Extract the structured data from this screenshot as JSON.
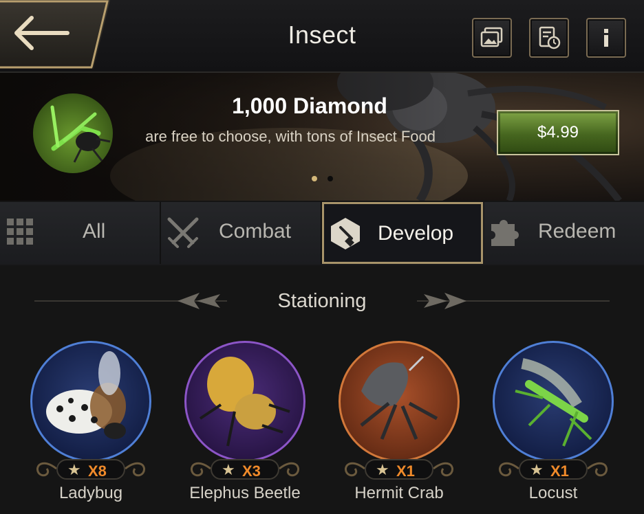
{
  "header": {
    "title": "Insect"
  },
  "offer": {
    "title": "1,000 Diamond",
    "description": "​ are free to choose, with tons of Insect Food",
    "price": "$4.99"
  },
  "tabs": [
    {
      "label": "All",
      "icon": "grid-icon"
    },
    {
      "label": "Combat",
      "icon": "crossed-swords-icon"
    },
    {
      "label": "Develop",
      "icon": "cube-shovel-icon",
      "active": true
    },
    {
      "label": "Redeem",
      "icon": "puzzle-piece-icon"
    }
  ],
  "section": {
    "title": "Stationing"
  },
  "insects": [
    {
      "name": "Ladybug",
      "count": "X8",
      "star": "★",
      "ring_color": "#4f7fd6"
    },
    {
      "name": "Elephus Beetle",
      "count": "X3",
      "star": "★",
      "ring_color": "#8c55c7"
    },
    {
      "name": "Hermit Crab",
      "count": "X1",
      "star": "★",
      "ring_color": "#d2783a"
    },
    {
      "name": "Locust",
      "count": "X1",
      "star": "★",
      "ring_color": "#4f7fd6"
    }
  ],
  "colors": {
    "accent_gold": "#a8946a",
    "count_orange": "#f08a2a",
    "price_green": "#5d8430"
  }
}
